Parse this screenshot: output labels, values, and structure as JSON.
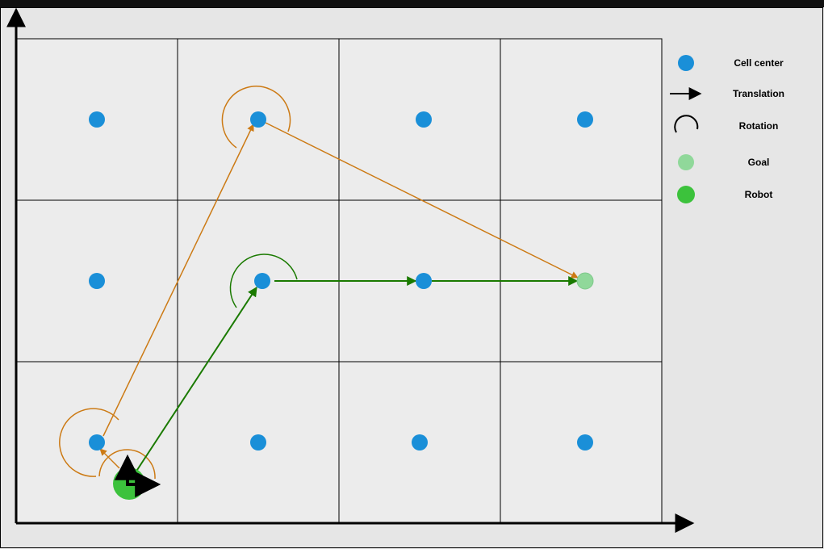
{
  "legend": {
    "cell_center": "Cell center",
    "translation": "Translation",
    "rotation": "Rotation",
    "goal": "Goal",
    "robot": "Robot"
  },
  "colors": {
    "cell_center": "#1a8fd8",
    "goal": "#90d89a",
    "robot": "#3cc23c",
    "path_orange": "#cc7a14",
    "path_green": "#1a7a00",
    "grid_fill": "#ececec",
    "grid_line": "#000000",
    "background": "#e6e6e6"
  },
  "grid": {
    "rows": 3,
    "cols": 4
  },
  "paths": [
    {
      "color_key": "path_orange",
      "cells": [
        "robot",
        "r2c0",
        "r0c1",
        "goal"
      ]
    },
    {
      "color_key": "path_green",
      "cells": [
        "robot",
        "r1c1",
        "r1c2",
        "goal"
      ]
    }
  ]
}
